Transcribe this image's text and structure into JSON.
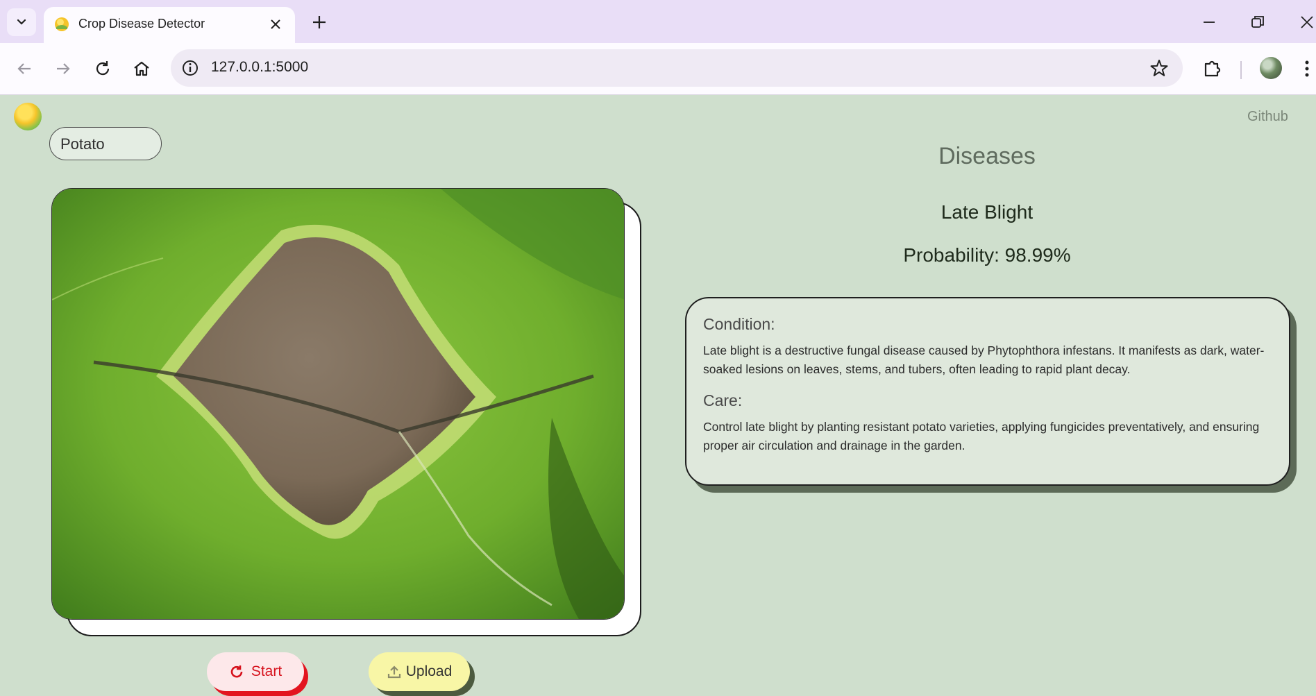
{
  "browser": {
    "tab_title": "Crop Disease Detector",
    "url": "127.0.0.1:5000"
  },
  "page": {
    "github_label": "Github",
    "crop_select_value": "Potato",
    "start_label": "Start",
    "upload_label": "Upload",
    "results_heading": "Diseases",
    "disease_name": "Late Blight",
    "probability": "Probability: 98.99%",
    "condition_heading": "Condition:",
    "condition_text": "Late blight is a destructive fungal disease caused by Phytophthora infestans. It manifests as dark, water-soaked lesions on leaves, stems, and tubers, often leading to rapid plant decay.",
    "care_heading": "Care:",
    "care_text": "Control late blight by planting resistant potato varieties, applying fungicides preventatively, and ensuring proper air circulation and drainage in the garden."
  },
  "colors": {
    "page_background": "#cfdfcd",
    "start_accent": "#e3141f",
    "upload_fill": "#f8f6a6"
  },
  "icons": [
    "tab-search-icon",
    "favicon-icon",
    "close-icon",
    "plus-icon",
    "minimize-icon",
    "restore-icon",
    "window-close-icon",
    "back-icon",
    "forward-icon",
    "reload-icon",
    "home-icon",
    "site-info-icon",
    "star-icon",
    "extensions-icon",
    "menu-icon",
    "refresh-icon",
    "upload-icon"
  ]
}
